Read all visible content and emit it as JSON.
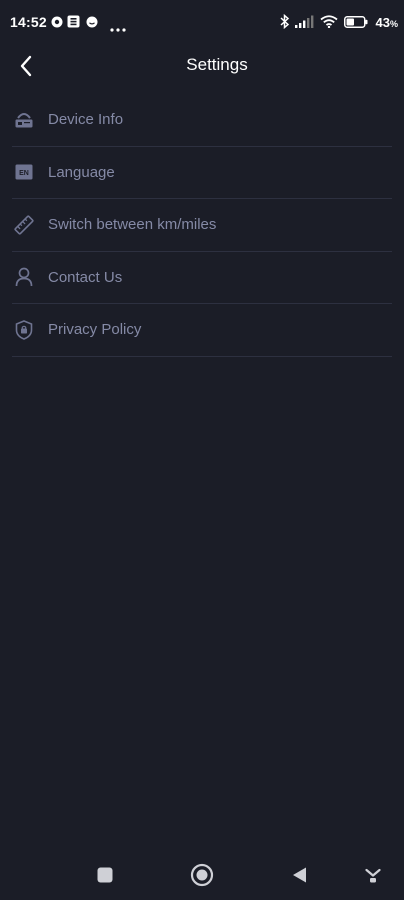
{
  "status_bar": {
    "time": "14:52",
    "battery": "43",
    "battery_unit": "%",
    "notifications": [
      "notif-badge-icon",
      "notif-box-icon",
      "notif-face-icon",
      "more-dots-icon"
    ],
    "system_icons": [
      "bluetooth-icon",
      "signal-icon",
      "wifi-icon",
      "battery-icon"
    ]
  },
  "header": {
    "title": "Settings"
  },
  "menu": {
    "items": [
      {
        "label": "Device Info",
        "icon": "device-icon"
      },
      {
        "label": "Language",
        "icon": "language-icon"
      },
      {
        "label": "Switch between km/miles",
        "icon": "ruler-icon"
      },
      {
        "label": "Contact Us",
        "icon": "person-icon"
      },
      {
        "label": "Privacy Policy",
        "icon": "shield-icon"
      }
    ]
  },
  "colors": {
    "background": "#1b1d27",
    "text_muted": "#858aa6",
    "divider": "#2d3040",
    "title": "#ffffff"
  }
}
